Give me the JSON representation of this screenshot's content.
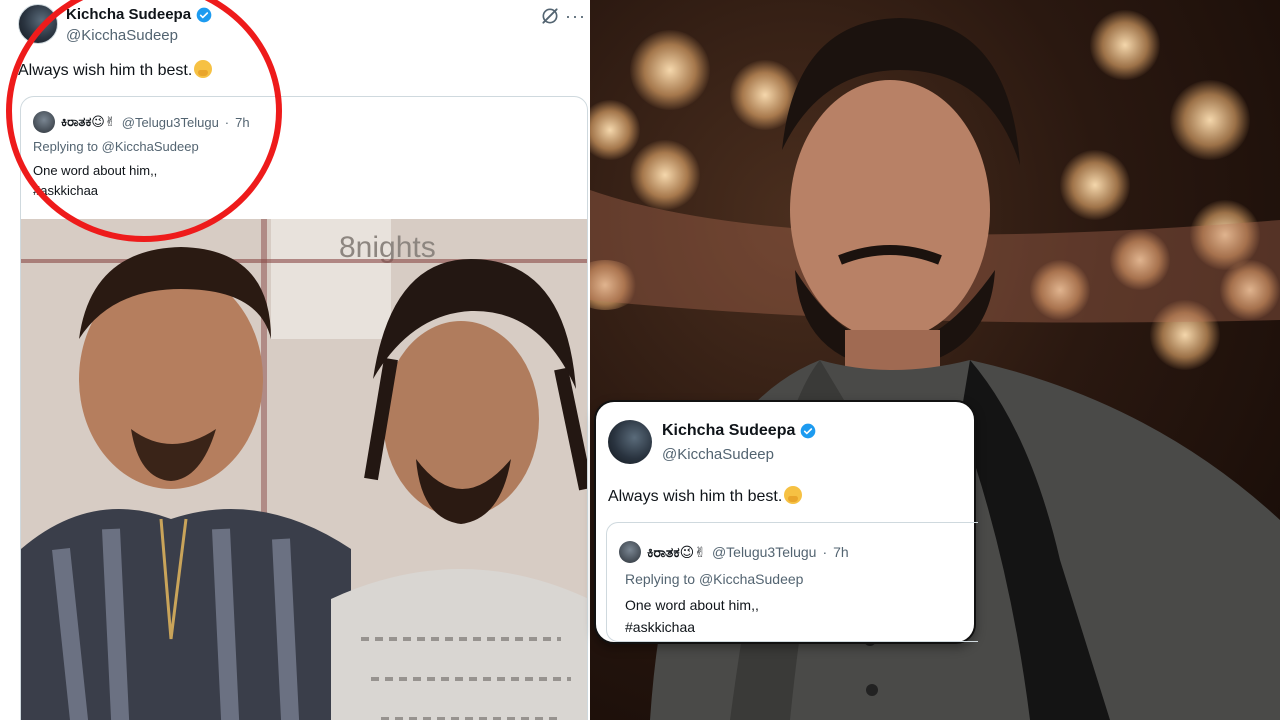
{
  "tweet": {
    "display_name": "Kichcha Sudeepa",
    "handle": "@KicchaSudeep",
    "text": "Always wish him th best.",
    "emoji": "hugging-face-emoji",
    "more_label": "···",
    "quoted": {
      "name": "ಕಿರಾತಕ😉✌",
      "handle": "@Telugu3Telugu",
      "separator": "·",
      "time": "7h",
      "reply_prefix": "Replying to",
      "reply_to": "@KicchaSudeep",
      "line1": "One word about him,,",
      "line2": "#askkichaa"
    }
  },
  "colors": {
    "highlight_circle": "#ee1b1b",
    "verified_badge": "#1d9bf0",
    "text_primary": "#0f1419",
    "text_secondary": "#536471",
    "card_border": "#cfd9de"
  },
  "icons": {
    "verified": "verified-badge-icon",
    "grok": "grok-icon",
    "more": "more-options-icon"
  }
}
